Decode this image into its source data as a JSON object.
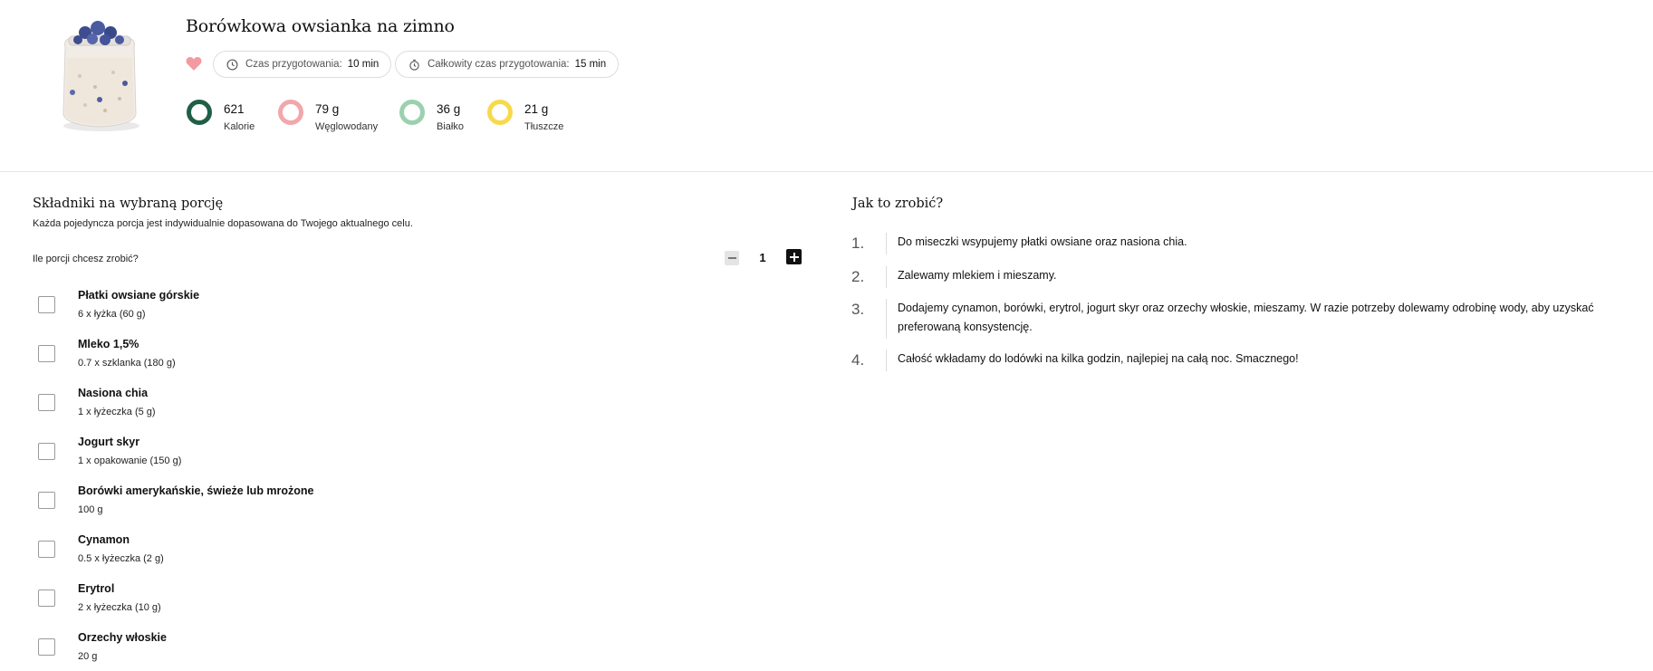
{
  "recipe": {
    "title": "Borówkowa owsianka na zimno",
    "prep_label": "Czas przygotowania:",
    "prep_value": "10 min",
    "total_label": "Całkowity czas przygotowania:",
    "total_value": "15 min",
    "favorite_color": "#f29aa0"
  },
  "macros": [
    {
      "value": "621",
      "label": "Kalorie",
      "color": "#1f5f45"
    },
    {
      "value": "79 g",
      "label": "Węglowodany",
      "color": "#f2a7ab"
    },
    {
      "value": "36 g",
      "label": "Białko",
      "color": "#9cd0ae"
    },
    {
      "value": "21 g",
      "label": "Tłuszcze",
      "color": "#f7d94a"
    }
  ],
  "ingredients_section": {
    "title": "Składniki na wybraną porcję",
    "subtitle": "Każda pojedyncza porcja jest indywidualnie dopasowana do Twojego aktualnego celu.",
    "portions_question": "Ile porcji chcesz zrobić?",
    "portions": "1",
    "items": [
      {
        "name": "Płatki owsiane górskie",
        "amount": "6 x łyżka (60 g)"
      },
      {
        "name": "Mleko 1,5%",
        "amount": "0.7 x szklanka (180 g)"
      },
      {
        "name": "Nasiona chia",
        "amount": "1 x łyżeczka (5 g)"
      },
      {
        "name": "Jogurt skyr",
        "amount": "1 x opakowanie (150 g)"
      },
      {
        "name": "Borówki amerykańskie, świeże lub mrożone",
        "amount": "100 g"
      },
      {
        "name": "Cynamon",
        "amount": "0.5 x łyżeczka (2 g)"
      },
      {
        "name": "Erytrol",
        "amount": "2 x łyżeczka (10 g)"
      },
      {
        "name": "Orzechy włoskie",
        "amount": "20 g"
      }
    ]
  },
  "steps_section": {
    "title": "Jak to zrobić?",
    "steps": [
      {
        "num": "1.",
        "text": "Do miseczki wsypujemy płatki owsiane oraz nasiona chia."
      },
      {
        "num": "2.",
        "text": "Zalewamy mlekiem i mieszamy."
      },
      {
        "num": "3.",
        "text": "Dodajemy cynamon, borówki, erytrol, jogurt skyr oraz orzechy włoskie, mieszamy. W razie potrzeby dolewamy odrobinę wody, aby uzyskać preferowaną konsystencję."
      },
      {
        "num": "4.",
        "text": "Całość wkładamy do lodówki na kilka godzin, najlepiej na całą noc. Smacznego!"
      }
    ]
  }
}
